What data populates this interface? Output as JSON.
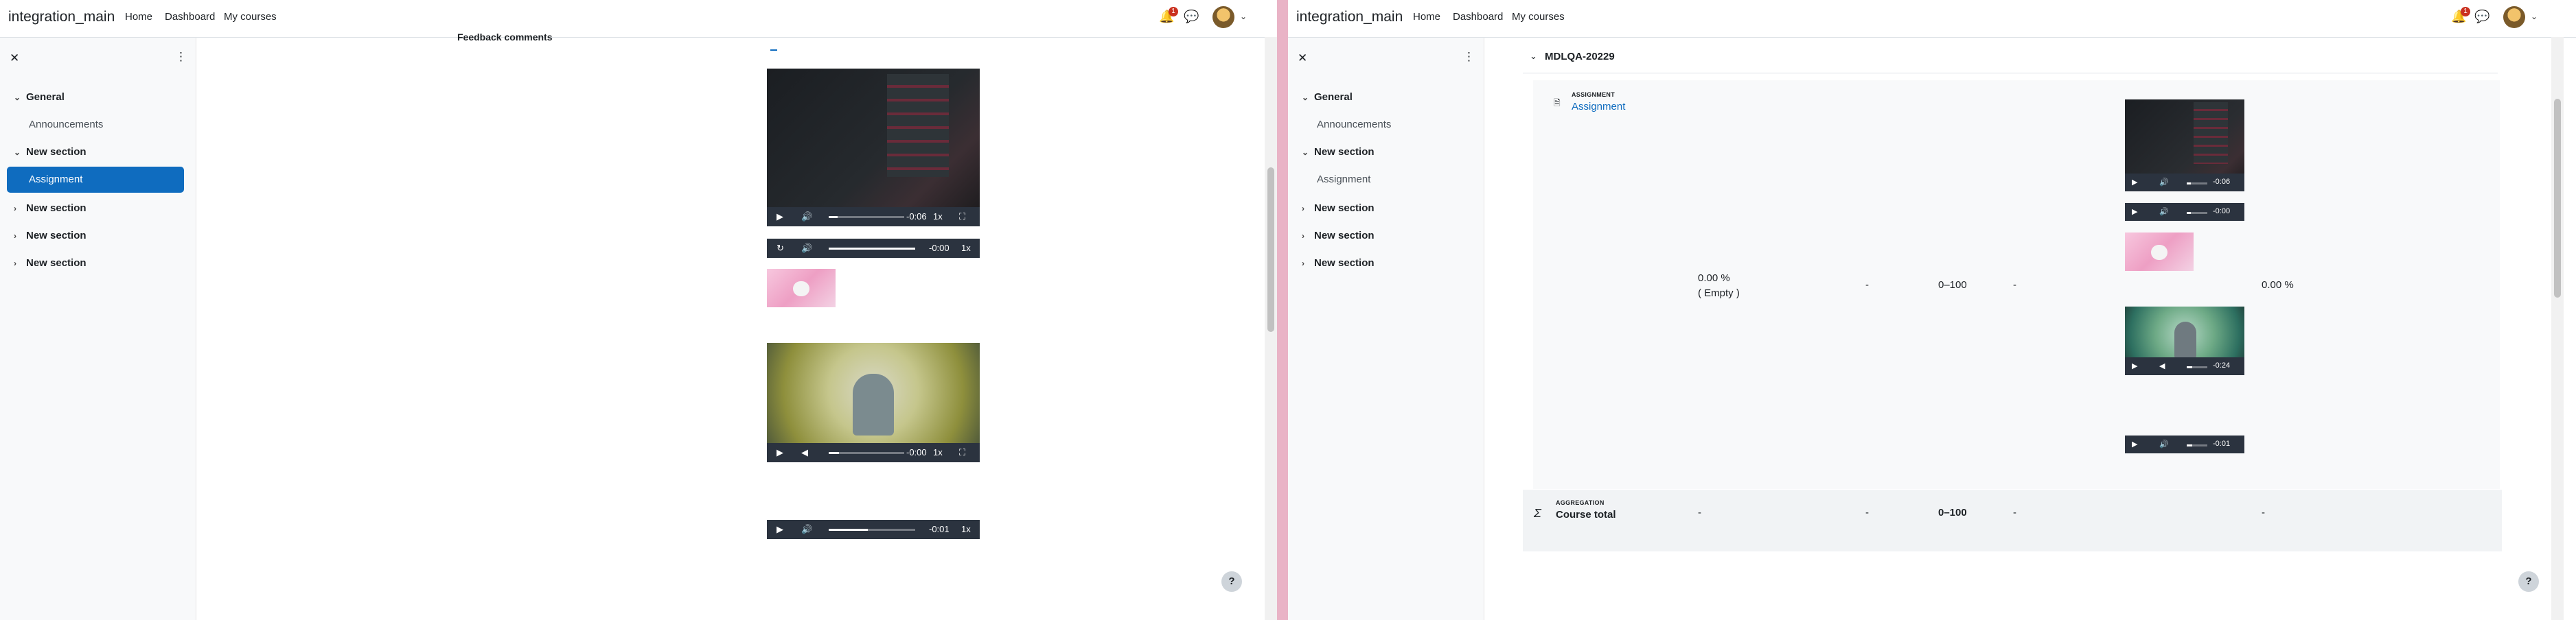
{
  "left": {
    "brand": "integration_main",
    "nav": [
      "Home",
      "Dashboard",
      "My courses"
    ],
    "notifications_count": "1",
    "drawer": {
      "sections": [
        {
          "title": "General",
          "items": [
            "Announcements"
          ]
        },
        {
          "title": "New section",
          "items": [
            "Assignment"
          ]
        },
        {
          "title": "New section",
          "items": []
        },
        {
          "title": "New section",
          "items": []
        },
        {
          "title": "New section",
          "items": []
        }
      ],
      "active_item": "Assignment"
    },
    "feedback_heading": "Feedback comments",
    "media": [
      {
        "kind": "video",
        "time": "-0:06",
        "speed": "1x",
        "progress": 0.1
      },
      {
        "kind": "audio",
        "time": "-0:00",
        "speed": "1x",
        "progress": 1.0
      },
      {
        "kind": "image"
      },
      {
        "kind": "video",
        "time": "-0:00",
        "speed": "1x",
        "progress": 0.12
      },
      {
        "kind": "audio",
        "time": "-0:01",
        "speed": "1x",
        "progress": 0.45
      }
    ],
    "help": "?"
  },
  "right": {
    "brand": "integration_main",
    "nav": [
      "Home",
      "Dashboard",
      "My courses"
    ],
    "notifications_count": "1",
    "drawer": {
      "sections": [
        {
          "title": "General",
          "items": [
            "Announcements"
          ]
        },
        {
          "title": "New section",
          "items": [
            "Assignment"
          ]
        },
        {
          "title": "New section",
          "items": []
        },
        {
          "title": "New section",
          "items": []
        },
        {
          "title": "New section",
          "items": []
        }
      ]
    },
    "grade_category": "MDLQA-20229",
    "row": {
      "type_label": "ASSIGNMENT",
      "name": "Assignment",
      "weight": "0.00 %",
      "weight_note": "( Empty )",
      "grade": "-",
      "range": "0–100",
      "percentage": "-",
      "contribution": "0.00 %"
    },
    "media": [
      {
        "kind": "video",
        "time": "-0:06"
      },
      {
        "kind": "audio",
        "time": "-0:00"
      },
      {
        "kind": "image"
      },
      {
        "kind": "video",
        "time": "-0:24"
      },
      {
        "kind": "audio",
        "time": "-0:01"
      }
    ],
    "total": {
      "type_label": "AGGREGATION",
      "name": "Course total",
      "weight": "-",
      "grade": "-",
      "range": "0–100",
      "percentage": "-",
      "contribution": "-"
    },
    "help": "?"
  }
}
